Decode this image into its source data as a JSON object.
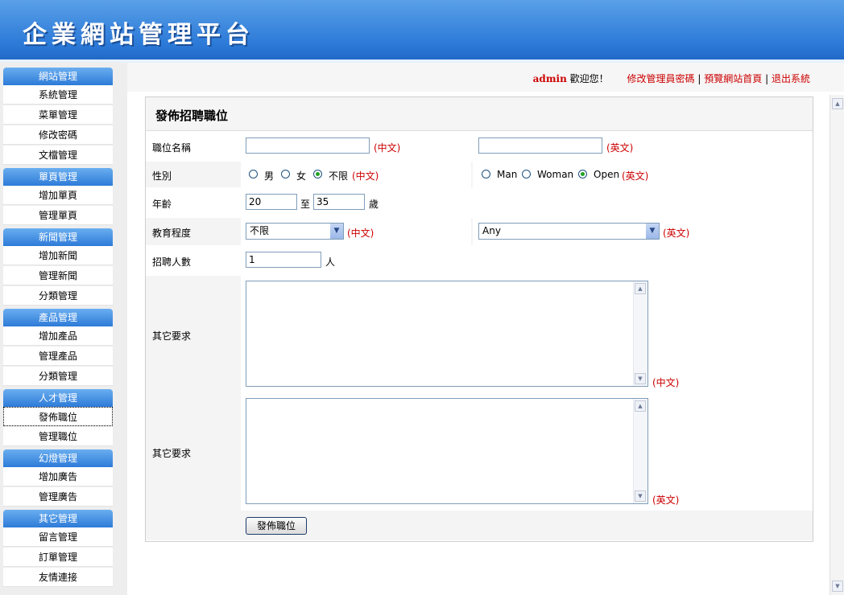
{
  "app": {
    "title": "企業網站管理平台"
  },
  "topbar": {
    "user": "admin",
    "welcome": "歡迎您！",
    "links": [
      "修改管理員密碼",
      "預覽網站首頁",
      "退出系統"
    ],
    "separator": "|"
  },
  "sidebar": {
    "groups": [
      {
        "title": "網站管理",
        "items": [
          "系統管理",
          "菜單管理",
          "修改密碼",
          "文檔管理"
        ]
      },
      {
        "title": "單頁管理",
        "items": [
          "增加單頁",
          "管理單頁"
        ]
      },
      {
        "title": "新聞管理",
        "items": [
          "增加新聞",
          "管理新聞",
          "分類管理"
        ]
      },
      {
        "title": "產品管理",
        "items": [
          "增加產品",
          "管理產品",
          "分類管理"
        ]
      },
      {
        "title": "人才管理",
        "items": [
          "發佈職位",
          "管理職位"
        ]
      },
      {
        "title": "幻燈管理",
        "items": [
          "增加廣告",
          "管理廣告"
        ]
      },
      {
        "title": "其它管理",
        "items": [
          "留言管理",
          "訂單管理",
          "友情連接"
        ]
      }
    ],
    "active_item": "發佈職位"
  },
  "form": {
    "title": "發佈招聘職位",
    "position_label": "職位名稱",
    "position_cn_value": "",
    "position_en_value": "",
    "cn_tag": "(中文)",
    "en_tag": "(英文)",
    "gender_label": "性別",
    "gender_cn_options": [
      "男",
      "女",
      "不限"
    ],
    "gender_cn_selected": "不限",
    "gender_en_options": [
      "Man",
      "Woman",
      "Open"
    ],
    "gender_en_selected": "Open",
    "age_label": "年齡",
    "age_from": "20",
    "age_to_word": "至",
    "age_to": "35",
    "age_unit": "歲",
    "education_label": "教育程度",
    "education_cn_value": "不限",
    "education_en_value": "Any",
    "headcount_label": "招聘人數",
    "headcount_value": "1",
    "headcount_unit": "人",
    "other_cn_label": "其它要求",
    "other_en_label": "其它要求",
    "submit_label": "發佈職位"
  }
}
